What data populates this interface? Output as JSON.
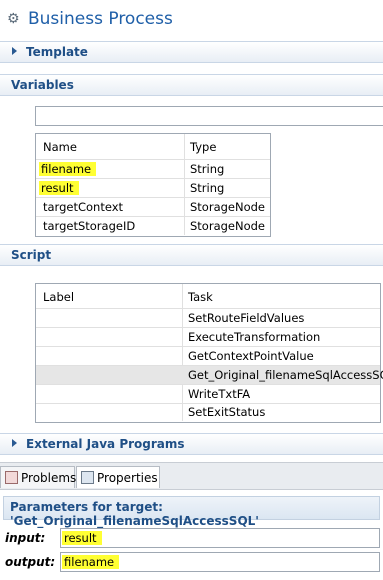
{
  "header": {
    "title": "Business Process",
    "icon": "gear-icon"
  },
  "sections": {
    "template": "Template",
    "variables": "Variables",
    "script": "Script",
    "external_java": "External Java Programs"
  },
  "variables": {
    "filter_value": "",
    "columns": [
      "Name",
      "Type"
    ],
    "rows": [
      {
        "name": "filename",
        "type": "String",
        "highlighted": true
      },
      {
        "name": "result",
        "type": "String",
        "highlighted": true
      },
      {
        "name": "targetContext",
        "type": "StorageNode",
        "highlighted": false
      },
      {
        "name": "targetStorageID",
        "type": "StorageNode",
        "highlighted": false
      }
    ]
  },
  "script": {
    "columns": [
      "Label",
      "Task"
    ],
    "rows": [
      {
        "label": "",
        "task": "SetRouteFieldValues"
      },
      {
        "label": "",
        "task": "ExecuteTransformation"
      },
      {
        "label": "",
        "task": "GetContextPointValue"
      },
      {
        "label": "",
        "task": "Get_Original_filenameSqlAccessSQL",
        "selected": true
      },
      {
        "label": "",
        "task": "WriteTxtFA"
      },
      {
        "label": "",
        "task": "SetExitStatus"
      }
    ]
  },
  "tabs": [
    {
      "label": "Problems",
      "active": false
    },
    {
      "label": "Properties",
      "active": true
    }
  ],
  "parameters": {
    "title": "Parameters for target: 'Get_Original_filenameSqlAccessSQL'",
    "input_label": "input:",
    "input_value": "result",
    "output_label": "output:",
    "output_value": "filename"
  },
  "colors": {
    "accent": "#1f4f86",
    "title": "#1f5fa8",
    "highlight": "#ffff33",
    "selected_row": "#e6e6e6"
  }
}
